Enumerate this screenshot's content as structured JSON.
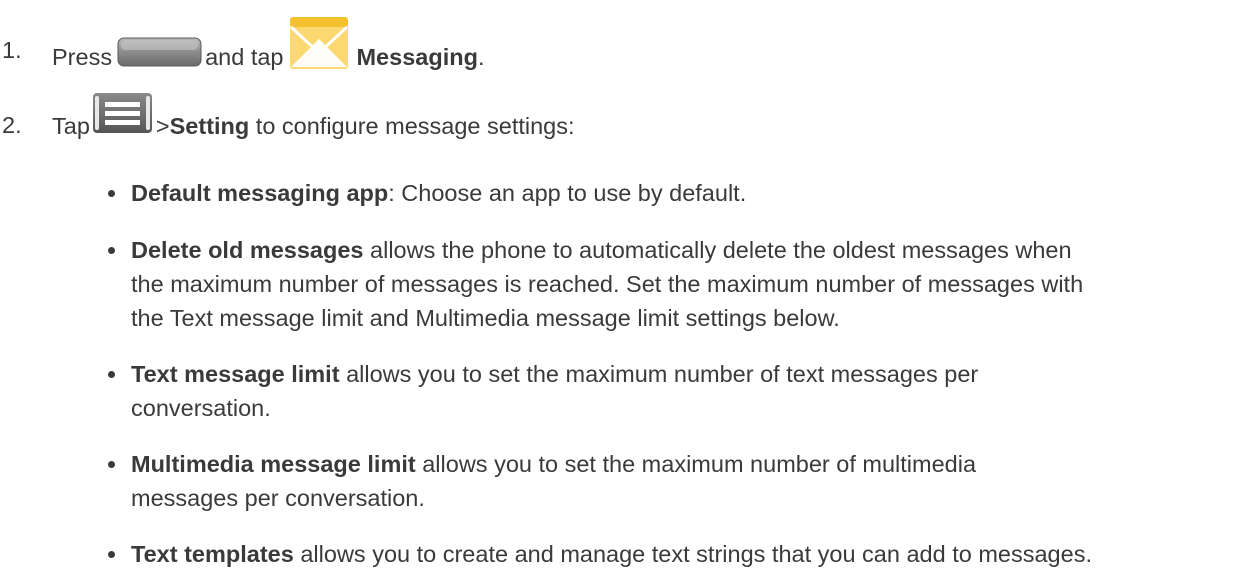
{
  "steps": [
    {
      "number": "1.",
      "parts": {
        "press": "Press",
        "and_tap": "and tap",
        "messaging": "Messaging",
        "period": "."
      },
      "icons": [
        "home-key-icon",
        "messaging-envelope-icon"
      ]
    },
    {
      "number": "2.",
      "parts": {
        "tap": "Tap",
        "gt": ">",
        "setting": "Setting",
        "rest": " to configure message settings:"
      },
      "icons": [
        "menu-key-icon"
      ]
    }
  ],
  "settings": [
    {
      "term": "Default messaging app",
      "desc_lines": [
        ": Choose an app to use by default."
      ]
    },
    {
      "term": "Delete old messages",
      "desc_lines": [
        " allows the phone to automatically delete the oldest messages when",
        "the maximum number of messages is reached. Set the maximum number of messages with",
        "the Text message limit and Multimedia message limit settings below."
      ]
    },
    {
      "term": "Text message limit",
      "desc_lines": [
        " allows you to set the maximum number of text messages per",
        "conversation."
      ]
    },
    {
      "term": "Multimedia message limit",
      "desc_lines": [
        " allows you to set the maximum number of multimedia",
        "messages per conversation."
      ]
    },
    {
      "term": "Text templates",
      "desc_lines": [
        " allows you to create and manage text strings that you can add to messages."
      ]
    }
  ],
  "colors": {
    "text": "#3a3a3a",
    "envelope_top": "#f5c12e",
    "envelope_body": "#fbd870"
  }
}
